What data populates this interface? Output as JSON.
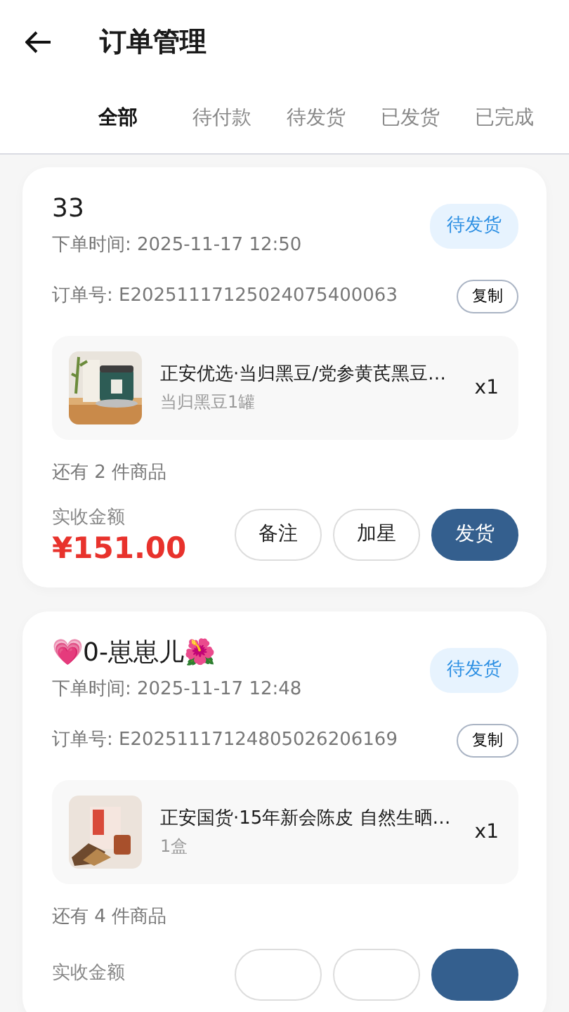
{
  "header": {
    "title": "订单管理"
  },
  "tabs": [
    {
      "label": "全部",
      "selected": true
    },
    {
      "label": "待付款",
      "selected": false
    },
    {
      "label": "待发货",
      "selected": false
    },
    {
      "label": "已发货",
      "selected": false
    },
    {
      "label": "已完成",
      "selected": false
    }
  ],
  "orders": [
    {
      "buyer": "33",
      "time": "下单时间: 2025-11-17 12:50",
      "status": "待发货",
      "order_no": "订单号: E20251117125024075400063",
      "copy": "复制",
      "product": {
        "kind": "picture",
        "title": "正安优选·当归黑豆/党参黄芪黑豆…",
        "spec": "当归黑豆1罐",
        "qty": "x1"
      },
      "more": "还有 2 件商品",
      "amount_label": "实收金额",
      "amount": "¥151.00",
      "actions": [
        {
          "label": "备注",
          "kind": "outline"
        },
        {
          "label": "加星",
          "kind": "outline"
        },
        {
          "label": "发货",
          "kind": "primary"
        }
      ]
    },
    {
      "buyer": "💗0-崽崽儿🌺",
      "time": "下单时间: 2025-11-17 12:48",
      "status": "待发货",
      "order_no": "订单号: E20251117124805026206169",
      "copy": "复制",
      "product": {
        "kind": "picture",
        "title": "正安国货·15年新会陈皮 自然生晒…",
        "spec": "1盒",
        "qty": "x1"
      },
      "more": "还有 4 件商品",
      "amount_label": "实收金额",
      "actions": [
        {
          "kind": "outline"
        },
        {
          "kind": "outline"
        },
        {
          "kind": "primary"
        }
      ]
    }
  ]
}
